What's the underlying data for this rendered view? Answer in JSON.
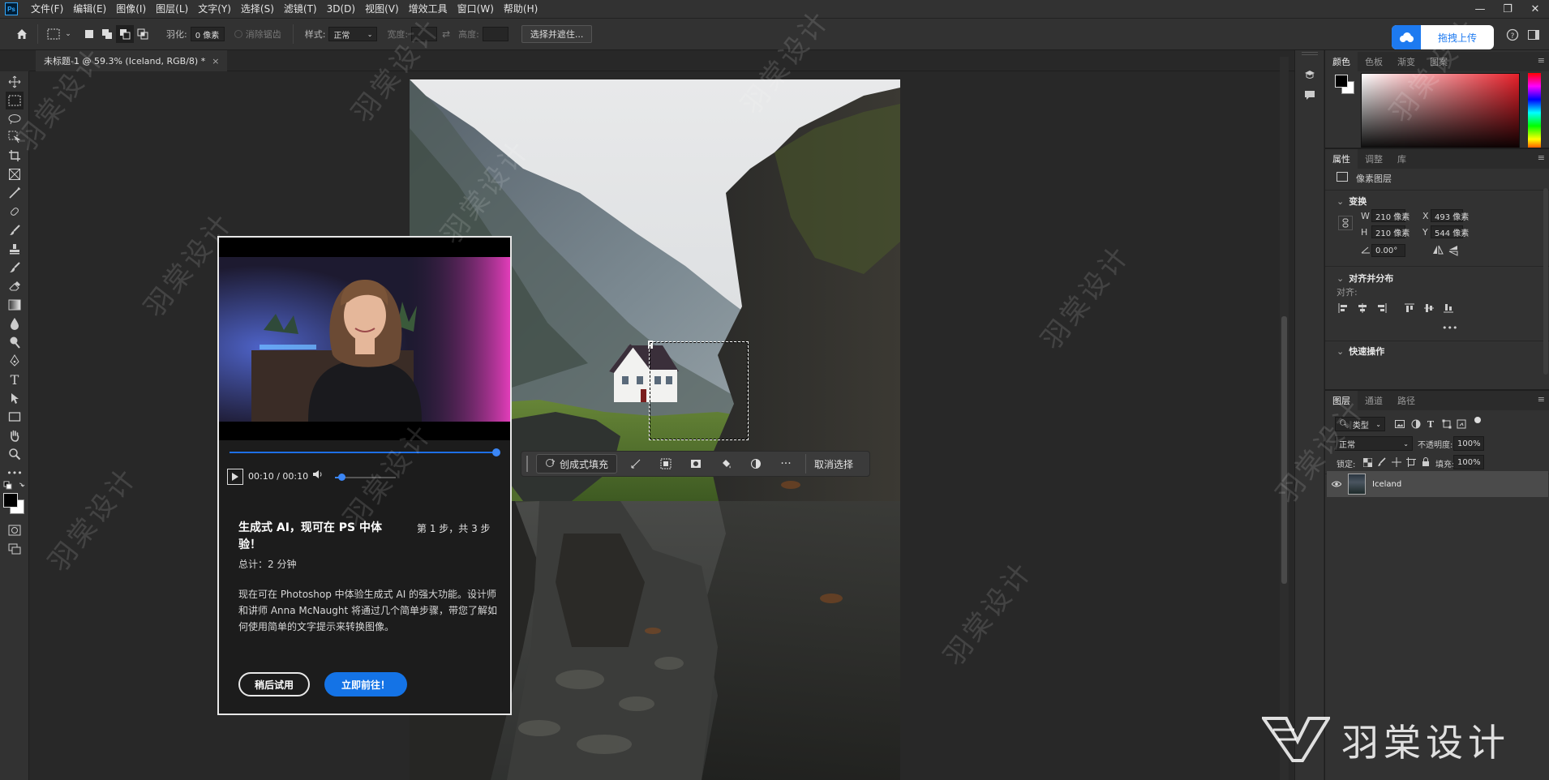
{
  "app": {
    "logo": "Ps",
    "menu": [
      "文件(F)",
      "编辑(E)",
      "图像(I)",
      "图层(L)",
      "文字(Y)",
      "选择(S)",
      "滤镜(T)",
      "3D(D)",
      "视图(V)",
      "增效工具",
      "窗口(W)",
      "帮助(H)"
    ],
    "window_controls": [
      "—",
      "❐",
      "✕"
    ]
  },
  "options": {
    "feather_label": "羽化:",
    "feather_value": "0 像素",
    "antialias_label": "消除锯齿",
    "style_label": "样式:",
    "style_value": "正常",
    "width_label": "宽度:",
    "height_label": "高度:",
    "select_mask_button": "选择并遮住...",
    "upload_button": "拖拽上传"
  },
  "document": {
    "tab_title": "未标题-1 @ 59.3% (Iceland, RGB/8) *"
  },
  "context_bar": {
    "generative_fill": "创成式填充",
    "more": "···",
    "deselect": "取消选择"
  },
  "learn_popup": {
    "time": "00:10 / 00:10",
    "video_progress": 1.0,
    "volume_level": 0.1,
    "title": "生成式 AI，现可在 PS 中体验！",
    "step": "第 1 步，共 3 步",
    "duration": "总计：2 分钟",
    "description": "现在可在 Photoshop 中体验生成式 AI 的强大功能。设计师和讲师 Anna McNaught 将通过几个简单步骤，带您了解如何使用简单的文字提示来转换图像。",
    "later_button": "稍后试用",
    "go_button": "立即前往！"
  },
  "color_panel": {
    "tabs": [
      "颜色",
      "色板",
      "渐变",
      "图案"
    ],
    "foreground": "#000000",
    "background": "#ffffff"
  },
  "properties_panel": {
    "tabs": [
      "属性",
      "调整",
      "库"
    ],
    "layer_type": "像素图层",
    "transform_title": "变换",
    "w_label": "W",
    "w_value": "210 像素",
    "h_label": "H",
    "h_value": "210 像素",
    "x_label": "X",
    "x_value": "493 像素",
    "y_label": "Y",
    "y_value": "544 像素",
    "angle_value": "0.00°",
    "align_title": "对齐并分布",
    "align_label": "对齐:",
    "more": "•••",
    "quick_actions_title": "快速操作"
  },
  "layers_panel": {
    "tabs": [
      "图层",
      "通道",
      "路径"
    ],
    "filter_kind": "类型",
    "blend_mode": "正常",
    "opacity_label": "不透明度:",
    "opacity_value": "100%",
    "lock_label": "锁定:",
    "fill_label": "填充:",
    "fill_value": "100%",
    "layer_name": "Iceland"
  },
  "watermark": {
    "text": "羽棠设计",
    "brand": "羽棠设计"
  },
  "colors": {
    "accent": "#1473e6",
    "ui_dark": "#323232",
    "canvas_bg": "#282828"
  }
}
